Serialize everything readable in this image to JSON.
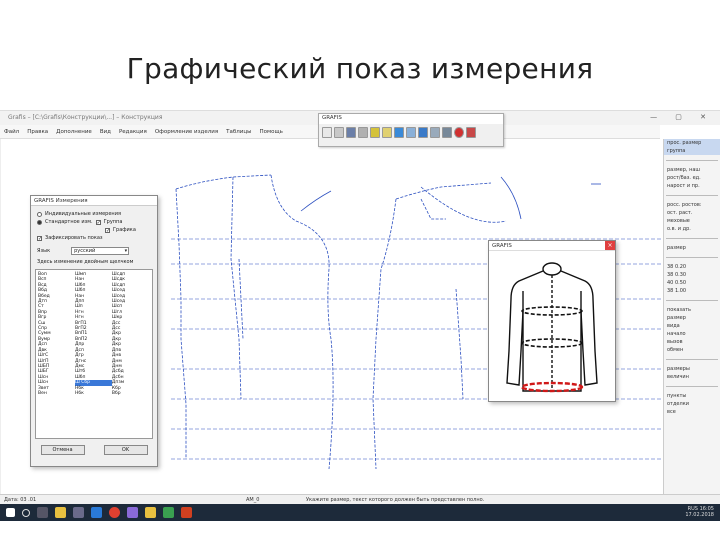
{
  "slide": {
    "title": "Графический показ измерения"
  },
  "window": {
    "title": "Grafis – [C:\\Grafis\\Конструкции\\...] – Конструкция"
  },
  "menu": [
    "Файл",
    "Правка",
    "Дополнение",
    "Вид",
    "Редакция",
    "Оформление изделия",
    "Таблицы",
    "Помощь"
  ],
  "toolbar": {
    "title": "GRAFIS"
  },
  "dialog_measure": {
    "title": "GRAFIS Измерения",
    "opt1": "Индивидуальные измерения",
    "opt2": "Стандартное изм.",
    "chk1": "Группа",
    "chk2": "Графика",
    "chk3": "Зафиксировать показ",
    "type_label": "Язык",
    "type_value": "русский",
    "hint": "Здесь изменение двойным щелчком",
    "list_col1": [
      "Воп",
      "Всп",
      "Вcд",
      "Вбд",
      "Вбед",
      "Дтп",
      "Ст",
      "Впр",
      "Вгр",
      "Сш",
      "Спр",
      "Сумм",
      "Вумр",
      "Дсп",
      "Двк",
      "ШгС",
      "ШгП",
      "ШБП",
      "ШБГ",
      "Шсн",
      "Шсн",
      "Звет",
      "Вен"
    ],
    "list_col2": [
      "Шмп",
      "Нан",
      "Шбп",
      "Шбп",
      "Нан",
      "Дпп",
      "Шп",
      "Нгн",
      "Нгн",
      "ВгП1",
      "ВгП2",
      "ВпП1",
      "ВпП2",
      "Дпр",
      "Дсп",
      "Дгр",
      "Дгнс",
      "Дмс",
      "Штб",
      "Шбп",
      "Ш Сбр",
      "Нбк",
      "Нбк"
    ],
    "list_col3": [
      "Шсдп",
      "Шсдк",
      "Шсдп",
      "Шсед",
      "Шсед",
      "Шсед",
      "Шсп",
      "Шгл",
      "Шкр",
      "Дсс",
      "Дсс",
      "Дкр",
      "Дкр",
      "Дкр",
      "Дпв",
      "Днв",
      "Днм",
      "Днм",
      "Дсбд",
      "Дсбн",
      "Дпзм",
      "Кбр",
      "Вбр"
    ],
    "selected": "Ш Сбр",
    "cancel": "Отмена",
    "ok": "OK"
  },
  "dialog_graphic": {
    "title": "GRAFIS"
  },
  "right_panel": {
    "items1": [
      "прос. размер",
      "группа"
    ],
    "items2": [
      "размер, наш",
      "рост/баз. ед.",
      "нарост и пр."
    ],
    "items3": [
      "росс. ростов:",
      "ост. раст.",
      "меховые",
      "о.в. и др."
    ],
    "items4": [
      "размер"
    ],
    "sizes": [
      "38  0.20",
      "38  0.30",
      "40  0.50",
      "38  1.00"
    ],
    "items5": [
      "показать",
      "размер",
      "вида",
      "начало",
      "вызов",
      "обмен"
    ],
    "items6": [
      "размеры",
      "величин"
    ],
    "items7": [
      "пункты",
      "отделки",
      "все"
    ]
  },
  "status": {
    "left": "Дата: 03 .01",
    "mid": "AM_0",
    "right": "Укажите размер, текст которого должен быть представлен полно."
  },
  "tray": {
    "lang": "RUS",
    "time": "16:05",
    "date": "17.02.2018"
  }
}
